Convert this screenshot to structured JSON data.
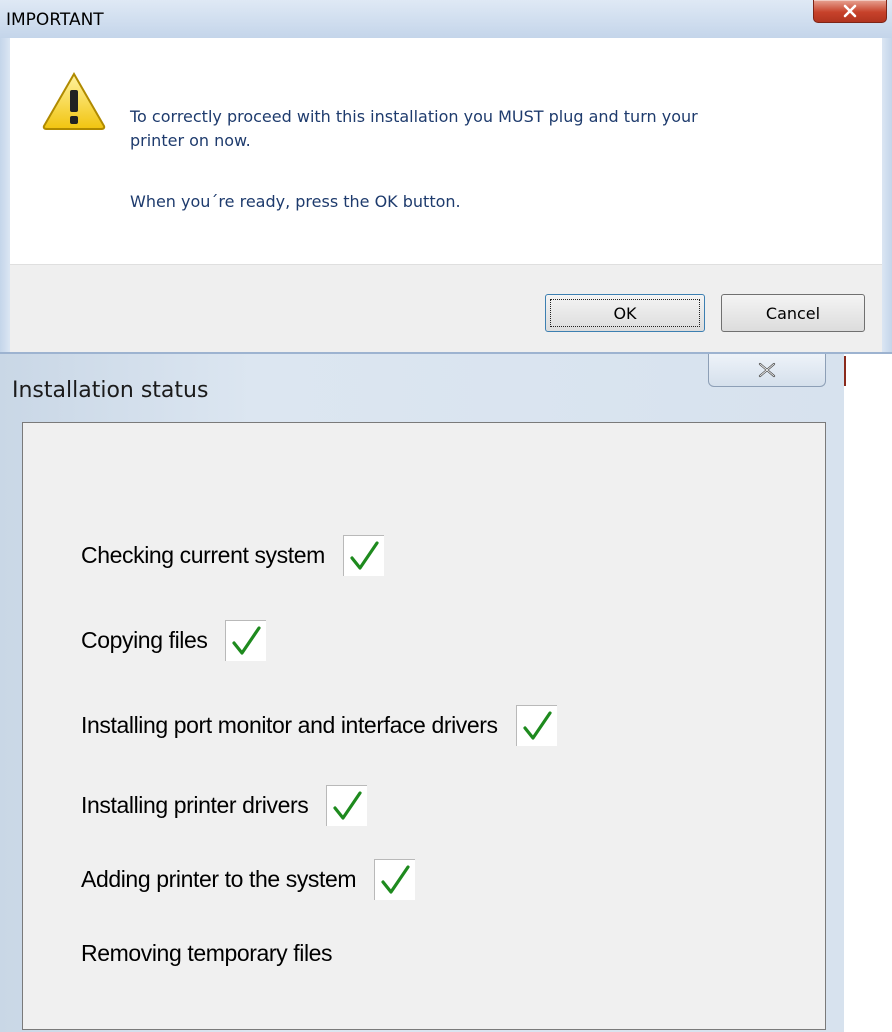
{
  "important_dialog": {
    "title": "IMPORTANT",
    "close_label": "×",
    "icon": "warning-icon",
    "message_line1": "To correctly proceed with this installation you MUST plug and turn your",
    "message_line2": "printer on now.",
    "message_line3": "When you´re ready, press the OK button.",
    "ok_label": "OK",
    "cancel_label": "Cancel"
  },
  "status_dialog": {
    "title": "Installation status",
    "close_label": "X",
    "steps": [
      {
        "label": "Checking current system",
        "done": true
      },
      {
        "label": "Copying files",
        "done": true
      },
      {
        "label": "Installing port monitor and interface drivers",
        "done": true
      },
      {
        "label": "Installing printer drivers",
        "done": true
      },
      {
        "label": "Adding printer to the system",
        "done": true
      },
      {
        "label": "Removing temporary files",
        "done": false
      }
    ]
  },
  "colors": {
    "message_text": "#1e3b6d",
    "check_green": "#1e8a1e",
    "close_red": "#c7422b"
  }
}
